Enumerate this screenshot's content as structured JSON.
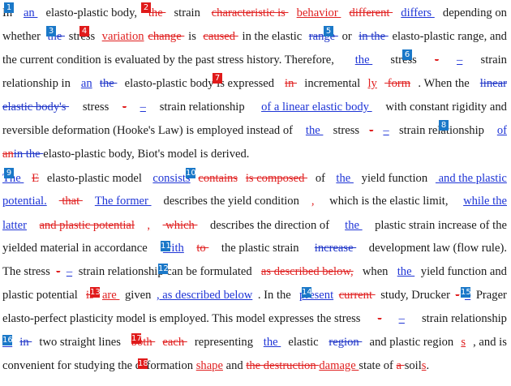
{
  "colors": {
    "insert_blue": "#1f35d6",
    "delete_red": "#e02020",
    "marker_blue": "#1a78c8",
    "marker_red": "#e01a1a"
  },
  "markers": [
    "1",
    "2",
    "3",
    "4",
    "5",
    "6",
    "7",
    "8",
    "9",
    "10",
    "11",
    "12",
    "13",
    "14",
    "15",
    "16",
    "17",
    "18"
  ],
  "lines": [
    [
      {
        "t": "In ",
        "s": ""
      },
      {
        "t": "an ",
        "s": "ins"
      },
      {
        "t": "elasto-plastic body, ",
        "s": ""
      },
      {
        "t": "the ",
        "s": "del"
      },
      {
        "t": "strain ",
        "s": ""
      },
      {
        "t": "characteristic is ",
        "s": "del"
      },
      {
        "t": "behavior ",
        "s": "insr"
      },
      {
        "t": "different ",
        "s": "del"
      },
      {
        "t": "differs ",
        "s": "ins"
      },
      {
        "t": "depending on",
        "s": ""
      }
    ],
    [
      {
        "t": "whether ",
        "s": ""
      },
      {
        "t": "the ",
        "s": "delb"
      },
      {
        "t": "stress ",
        "s": ""
      },
      {
        "t": "variation",
        "s": "insr"
      },
      {
        "t": "change ",
        "s": "del"
      },
      {
        "t": "is ",
        "s": ""
      },
      {
        "t": "caused ",
        "s": "del"
      },
      {
        "t": "in the elastic ",
        "s": ""
      },
      {
        "t": "range ",
        "s": "delb"
      },
      {
        "t": "or ",
        "s": ""
      },
      {
        "t": "in the ",
        "s": "delb"
      },
      {
        "t": "elasto-plastic range, and",
        "s": ""
      }
    ],
    [
      {
        "t": "the current condition is evaluated by the past stress history. Therefore, ",
        "s": ""
      },
      {
        "t": "the ",
        "s": "ins"
      },
      {
        "t": "stress",
        "s": ""
      },
      {
        "t": "-",
        "s": "del"
      },
      {
        "t": "–",
        "s": "ins"
      },
      {
        "t": "strain",
        "s": ""
      }
    ],
    [
      {
        "t": "relationship in ",
        "s": ""
      },
      {
        "t": "an",
        "s": "ins"
      },
      {
        "t": "the ",
        "s": "delb"
      },
      {
        "t": "elasto-plastic body is expressed ",
        "s": ""
      },
      {
        "t": "in ",
        "s": "del"
      },
      {
        "t": "incremental",
        "s": ""
      },
      {
        "t": "ly",
        "s": "insr"
      },
      {
        "t": " form",
        "s": "del"
      },
      {
        "t": ". When the ",
        "s": ""
      },
      {
        "t": "linear",
        "s": "delb"
      }
    ],
    [
      {
        "t": "elastic body's ",
        "s": "delb"
      },
      {
        "t": "stress",
        "s": ""
      },
      {
        "t": "-",
        "s": "del"
      },
      {
        "t": "–",
        "s": "ins"
      },
      {
        "t": "strain relationship ",
        "s": ""
      },
      {
        "t": "of a linear elastic body ",
        "s": "ins"
      },
      {
        "t": "with constant rigidity and",
        "s": ""
      }
    ],
    [
      {
        "t": "reversible deformation (Hooke's Law) is employed instead of ",
        "s": ""
      },
      {
        "t": "the ",
        "s": "ins"
      },
      {
        "t": "stress",
        "s": ""
      },
      {
        "t": "-",
        "s": "del"
      },
      {
        "t": "–",
        "s": "ins"
      },
      {
        "t": "strain relationship ",
        "s": ""
      },
      {
        "t": "of",
        "s": "ins"
      }
    ],
    [
      {
        "t": "an",
        "s": "del"
      },
      {
        "t": "in the ",
        "s": "delb"
      },
      {
        "t": "elasto-plastic body, Biot's model is derived.",
        "s": ""
      }
    ],
    [
      {
        "t": "The ",
        "s": "ins"
      },
      {
        "t": "E",
        "s": "del"
      },
      {
        "t": "elasto-plastic model ",
        "s": ""
      },
      {
        "t": "consists",
        "s": "ins"
      },
      {
        "t": "contains",
        "s": "del"
      },
      {
        "t": "is composed ",
        "s": "del"
      },
      {
        "t": "of ",
        "s": ""
      },
      {
        "t": "the ",
        "s": "ins"
      },
      {
        "t": "yield function",
        "s": ""
      },
      {
        "t": " and the plastic",
        "s": "ins"
      }
    ],
    [
      {
        "t": "potential.",
        "s": "ins"
      },
      {
        "t": " that ",
        "s": "del"
      },
      {
        "t": "The former ",
        "s": "ins"
      },
      {
        "t": "describes the yield condition",
        "s": ""
      },
      {
        "t": ",",
        "s": "insr"
      },
      {
        "t": " which is the elastic limit, ",
        "s": ""
      },
      {
        "t": "while the",
        "s": "ins"
      }
    ],
    [
      {
        "t": "latter",
        "s": "ins"
      },
      {
        "t": "and plastic potential",
        "s": "del"
      },
      {
        "t": ",",
        "s": "insr"
      },
      {
        "t": " which ",
        "s": "del"
      },
      {
        "t": "describes the direction of ",
        "s": ""
      },
      {
        "t": "the ",
        "s": "ins"
      },
      {
        "t": "plastic strain increase of the",
        "s": ""
      }
    ],
    [
      {
        "t": "yielded material in accordance ",
        "s": ""
      },
      {
        "t": "with",
        "s": "ins"
      },
      {
        "t": "to ",
        "s": "del"
      },
      {
        "t": "the plastic strain ",
        "s": ""
      },
      {
        "t": "increase ",
        "s": "delb"
      },
      {
        "t": "development law (flow rule).",
        "s": ""
      }
    ],
    [
      {
        "t": "The stress",
        "s": ""
      },
      {
        "t": "-",
        "s": "del"
      },
      {
        "t": "–",
        "s": "ins"
      },
      {
        "t": "strain relationship can be formulated ",
        "s": ""
      },
      {
        "t": "as described below,",
        "s": "del"
      },
      {
        "t": " when ",
        "s": ""
      },
      {
        "t": "the ",
        "s": "ins"
      },
      {
        "t": "yield function and",
        "s": ""
      }
    ],
    [
      {
        "t": "plastic potential ",
        "s": ""
      },
      {
        "t": "is ",
        "s": "del"
      },
      {
        "t": "are ",
        "s": "insr"
      },
      {
        "t": "given",
        "s": ""
      },
      {
        "t": ", as described below",
        "s": "ins"
      },
      {
        "t": ". In the ",
        "s": ""
      },
      {
        "t": "present",
        "s": "ins"
      },
      {
        "t": "current ",
        "s": "del"
      },
      {
        "t": "study, Drucker",
        "s": ""
      },
      {
        "t": "-",
        "s": "del"
      },
      {
        "t": "–",
        "s": "ins"
      },
      {
        "t": "Prager",
        "s": ""
      }
    ],
    [
      {
        "t": "elasto-perfect plasticity model is employed. This model expresses the stress",
        "s": ""
      },
      {
        "t": "-",
        "s": "del"
      },
      {
        "t": "–",
        "s": "ins"
      },
      {
        "t": "strain relationship",
        "s": ""
      }
    ],
    [
      {
        "t": "as",
        "s": "ins"
      },
      {
        "t": "in ",
        "s": "delb"
      },
      {
        "t": "two straight lines ",
        "s": ""
      },
      {
        "t": "both ",
        "s": "del"
      },
      {
        "t": "each ",
        "s": "del"
      },
      {
        "t": "representing ",
        "s": ""
      },
      {
        "t": "the ",
        "s": "ins"
      },
      {
        "t": "elastic ",
        "s": ""
      },
      {
        "t": "region ",
        "s": "delb"
      },
      {
        "t": "and plastic region",
        "s": ""
      },
      {
        "t": "s",
        "s": "insr"
      },
      {
        "t": ", and is",
        "s": ""
      }
    ],
    [
      {
        "t": "convenient for studying the deformation ",
        "s": ""
      },
      {
        "t": "shape",
        "s": "insr"
      },
      {
        "t": " and ",
        "s": ""
      },
      {
        "t": "the destruction ",
        "s": "del"
      },
      {
        "t": "damage ",
        "s": "insr"
      },
      {
        "t": "state of ",
        "s": ""
      },
      {
        "t": "a ",
        "s": "del"
      },
      {
        "t": "soil",
        "s": ""
      },
      {
        "t": "s",
        "s": "insr"
      },
      {
        "t": ".",
        "s": ""
      }
    ]
  ]
}
